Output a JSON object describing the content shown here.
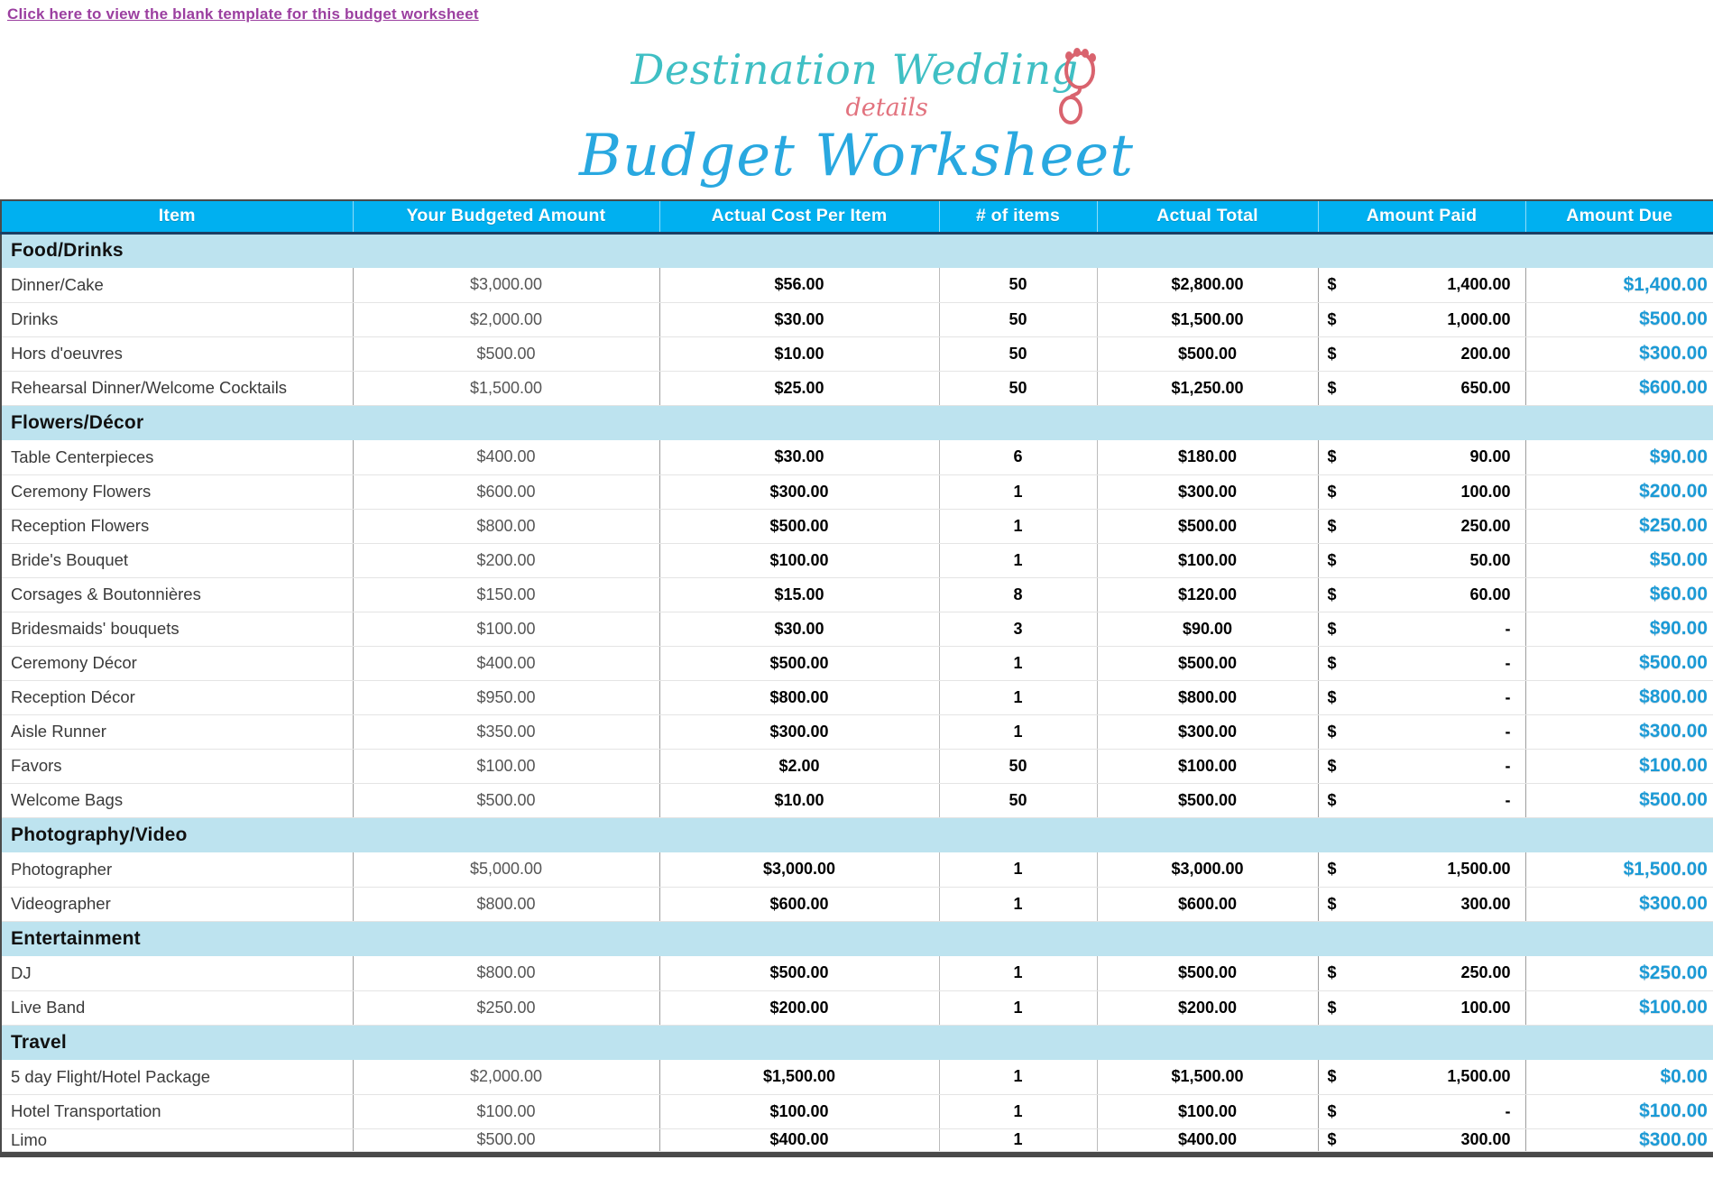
{
  "topbar": {
    "template_link": "Click here to view the blank template for this budget worksheet"
  },
  "branding": {
    "logo_main": "Destination Wedding",
    "logo_sub": "details",
    "logo_icon": "footprint-icon",
    "title": "Budget Worksheet",
    "colors": {
      "logo_teal": "#3fbfc4",
      "logo_pink": "#e2727e",
      "title_blue": "#29a8e0",
      "header_cyan": "#00b0f0",
      "section_band": "#bde3ef",
      "due_blue": "#1b9ad6",
      "link_purple": "#9b3fa0"
    }
  },
  "table": {
    "columns": [
      "Item",
      "Your Budgeted Amount",
      "Actual Cost Per Item",
      "# of items",
      "Actual Total",
      "Amount Paid",
      "Amount Due"
    ],
    "currency_symbol": "$",
    "sections": [
      {
        "name": "Food/Drinks",
        "rows": [
          {
            "item": "Dinner/Cake",
            "budget": "$3,000.00",
            "cost": "$56.00",
            "qty": "50",
            "total": "$2,800.00",
            "paid": "1,400.00",
            "due": "$1,400.00"
          },
          {
            "item": "Drinks",
            "budget": "$2,000.00",
            "cost": "$30.00",
            "qty": "50",
            "total": "$1,500.00",
            "paid": "1,000.00",
            "due": "$500.00"
          },
          {
            "item": "Hors d'oeuvres",
            "budget": "$500.00",
            "cost": "$10.00",
            "qty": "50",
            "total": "$500.00",
            "paid": "200.00",
            "due": "$300.00"
          },
          {
            "item": "Rehearsal Dinner/Welcome Cocktails",
            "budget": "$1,500.00",
            "cost": "$25.00",
            "qty": "50",
            "total": "$1,250.00",
            "paid": "650.00",
            "due": "$600.00"
          }
        ]
      },
      {
        "name": "Flowers/Décor",
        "rows": [
          {
            "item": "Table Centerpieces",
            "budget": "$400.00",
            "cost": "$30.00",
            "qty": "6",
            "total": "$180.00",
            "paid": "90.00",
            "due": "$90.00"
          },
          {
            "item": "Ceremony Flowers",
            "budget": "$600.00",
            "cost": "$300.00",
            "qty": "1",
            "total": "$300.00",
            "paid": "100.00",
            "due": "$200.00"
          },
          {
            "item": "Reception Flowers",
            "budget": "$800.00",
            "cost": "$500.00",
            "qty": "1",
            "total": "$500.00",
            "paid": "250.00",
            "due": "$250.00"
          },
          {
            "item": "Bride's Bouquet",
            "budget": "$200.00",
            "cost": "$100.00",
            "qty": "1",
            "total": "$100.00",
            "paid": "50.00",
            "due": "$50.00"
          },
          {
            "item": "Corsages & Boutonnières",
            "budget": "$150.00",
            "cost": "$15.00",
            "qty": "8",
            "total": "$120.00",
            "paid": "60.00",
            "due": "$60.00"
          },
          {
            "item": "Bridesmaids' bouquets",
            "budget": "$100.00",
            "cost": "$30.00",
            "qty": "3",
            "total": "$90.00",
            "paid": "-",
            "due": "$90.00"
          },
          {
            "item": "Ceremony Décor",
            "budget": "$400.00",
            "cost": "$500.00",
            "qty": "1",
            "total": "$500.00",
            "paid": "-",
            "due": "$500.00"
          },
          {
            "item": "Reception Décor",
            "budget": "$950.00",
            "cost": "$800.00",
            "qty": "1",
            "total": "$800.00",
            "paid": "-",
            "due": "$800.00"
          },
          {
            "item": "Aisle Runner",
            "budget": "$350.00",
            "cost": "$300.00",
            "qty": "1",
            "total": "$300.00",
            "paid": "-",
            "due": "$300.00"
          },
          {
            "item": "Favors",
            "budget": "$100.00",
            "cost": "$2.00",
            "qty": "50",
            "total": "$100.00",
            "paid": "-",
            "due": "$100.00"
          },
          {
            "item": "Welcome Bags",
            "budget": "$500.00",
            "cost": "$10.00",
            "qty": "50",
            "total": "$500.00",
            "paid": "-",
            "due": "$500.00"
          }
        ]
      },
      {
        "name": "Photography/Video",
        "rows": [
          {
            "item": "Photographer",
            "budget": "$5,000.00",
            "cost": "$3,000.00",
            "qty": "1",
            "total": "$3,000.00",
            "paid": "1,500.00",
            "due": "$1,500.00"
          },
          {
            "item": "Videographer",
            "budget": "$800.00",
            "cost": "$600.00",
            "qty": "1",
            "total": "$600.00",
            "paid": "300.00",
            "due": "$300.00"
          }
        ]
      },
      {
        "name": "Entertainment",
        "rows": [
          {
            "item": "DJ",
            "budget": "$800.00",
            "cost": "$500.00",
            "qty": "1",
            "total": "$500.00",
            "paid": "250.00",
            "due": "$250.00"
          },
          {
            "item": "Live Band",
            "budget": "$250.00",
            "cost": "$200.00",
            "qty": "1",
            "total": "$200.00",
            "paid": "100.00",
            "due": "$100.00"
          }
        ]
      },
      {
        "name": "Travel",
        "rows": [
          {
            "item": "5 day Flight/Hotel Package",
            "budget": "$2,000.00",
            "cost": "$1,500.00",
            "qty": "1",
            "total": "$1,500.00",
            "paid": "1,500.00",
            "due": "$0.00"
          },
          {
            "item": "Hotel Transportation",
            "budget": "$100.00",
            "cost": "$100.00",
            "qty": "1",
            "total": "$100.00",
            "paid": "-",
            "due": "$100.00"
          },
          {
            "item": "Limo",
            "budget": "$500.00",
            "cost": "$400.00",
            "qty": "1",
            "total": "$400.00",
            "paid": "300.00",
            "due": "$300.00",
            "clipped": true
          }
        ]
      }
    ]
  }
}
